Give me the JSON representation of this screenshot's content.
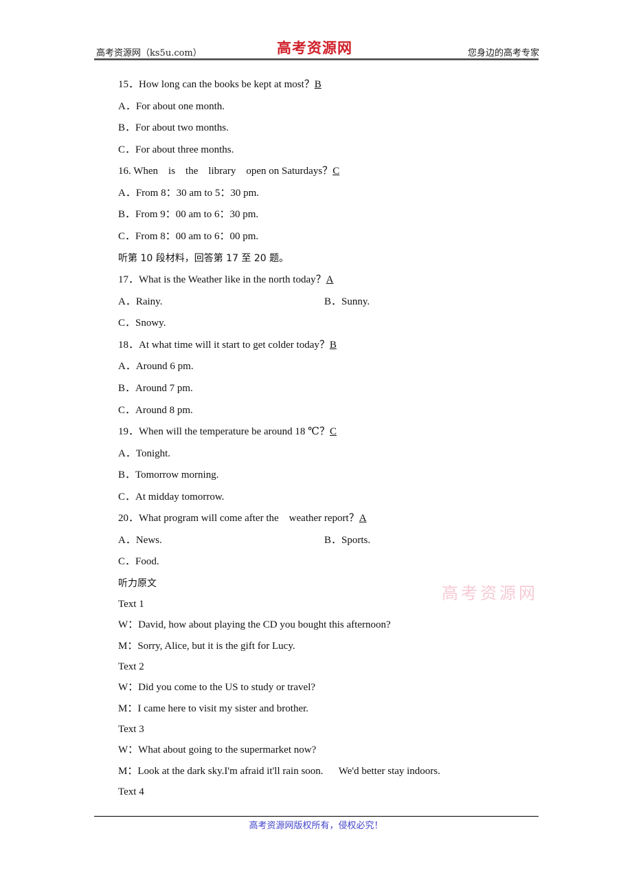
{
  "header": {
    "left": "高考资源网（ks5u.com）",
    "logo": "高考资源网",
    "right": "您身边的高考专家"
  },
  "questions": [
    {
      "stem": "15．How long can the books be kept at most？",
      "answer": "B",
      "options": [
        "A．For about one month.",
        "B．For about two months.",
        "C．For about three months."
      ]
    },
    {
      "stem": "16. When    is    the    library    open on Saturdays？",
      "answer": "C",
      "options": [
        "A．From 8：30 am to 5：30 pm.",
        "B．From 9：00 am to 6：30 pm.",
        "C．From 8：00 am to 6：00 pm."
      ]
    },
    {
      "stem": "17．What is the Weather like in the north today？",
      "answer": "A",
      "options": [
        "A．Rainy.",
        "B．Sunny.",
        "C．Snowy."
      ]
    },
    {
      "stem": "18．At what time will it start to get colder today？",
      "answer": "B",
      "options": [
        "A．Around 6 pm.",
        "B．Around 7 pm.",
        "C．Around 8 pm."
      ]
    },
    {
      "stem": "19．When will the temperature be around 18 ℃？",
      "answer": "C",
      "options": [
        "A．Tonight.",
        "B．Tomorrow morning.",
        "C．At midday tomorrow."
      ]
    },
    {
      "stem": "20．What program will come after the    weather report？",
      "answer": "A",
      "options": [
        "A．News.",
        "B．Sports.",
        "C．Food."
      ]
    }
  ],
  "section_instruction": "听第 10 段材料，回答第 17 至 20 题。",
  "transcript": {
    "heading": "听力原文",
    "texts": [
      {
        "title": "Text 1",
        "lines": [
          "W：David, how about playing the CD you bought this afternoon?",
          "M：Sorry, Alice, but it is the gift for Lucy."
        ]
      },
      {
        "title": "Text 2",
        "lines": [
          "W：Did you come to the US to study or travel?",
          "M：I came here to visit my sister and brother."
        ]
      },
      {
        "title": "Text 3",
        "lines": [
          "W：What about going to the supermarket now?",
          "M：Look at the dark sky.I'm afraid it'll rain soon.      We'd better stay indoors."
        ]
      },
      {
        "title": "Text 4",
        "lines": []
      }
    ]
  },
  "watermark": "高考资源网",
  "footer": "高考资源网版权所有，侵权必究！"
}
